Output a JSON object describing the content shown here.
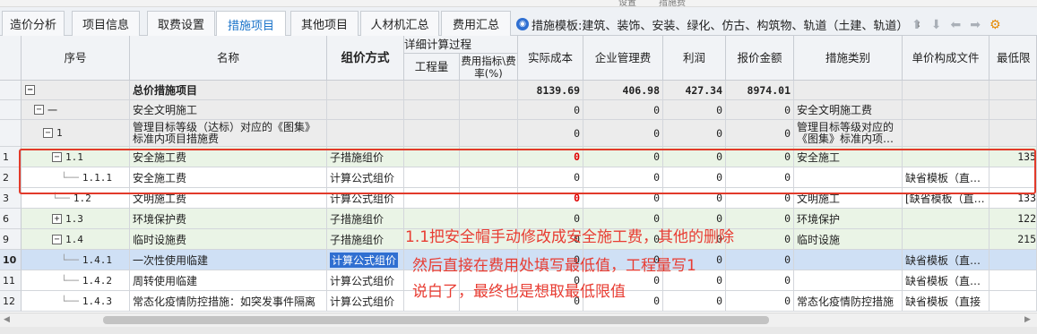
{
  "top_strip": [
    "设置",
    "措施费"
  ],
  "tabs": [
    {
      "label": "造价分析",
      "active": false
    },
    {
      "label": "项目信息",
      "active": false
    },
    {
      "label": "取费设置",
      "active": false
    },
    {
      "label": "措施项目",
      "active": true
    },
    {
      "label": "其他项目",
      "active": false
    },
    {
      "label": "人材机汇总",
      "active": false
    },
    {
      "label": "费用汇总",
      "active": false
    }
  ],
  "template": {
    "label": "措施模板:建筑、装饰、安装、绿化、仿古、构筑物、轨道（土建、轨道）",
    "dropdown_icon": "sort-arrows-icon"
  },
  "toolbar_icons": [
    "up-arrow-icon",
    "down-arrow-icon",
    "left-arrow-icon",
    "right-arrow-icon",
    "settings-icon"
  ],
  "headers": {
    "seq": "序号",
    "name": "名称",
    "pricing_method": "组价方式",
    "detail_group": "详细计算过程",
    "quantity": "工程量",
    "fee_rate": "费用指标\\费率(%)",
    "actual_cost": "实际成本",
    "mgmt_fee": "企业管理费",
    "profit": "利润",
    "quote_amount": "报价金额",
    "category": "措施类别",
    "unit_file": "单价构成文件",
    "min_limit": "最低限"
  },
  "rows": [
    {
      "rownum": "",
      "seq": "",
      "toggle": "−",
      "name": "总价措施项目",
      "method": "",
      "qty": "",
      "rate": "",
      "cost": "8139.69",
      "mgmt": "406.98",
      "profit": "427.34",
      "quote": "8974.01",
      "category": "",
      "unitfile": "",
      "min": "",
      "bold": true,
      "bg": "#ececec",
      "height": 22
    },
    {
      "rownum": "",
      "seq": "一",
      "toggle": "−",
      "name": "安全文明施工",
      "method": "",
      "qty": "",
      "rate": "",
      "cost": "0",
      "mgmt": "0",
      "profit": "0",
      "quote": "0",
      "category": "安全文明施工费",
      "unitfile": "",
      "min": "",
      "bold": false,
      "bg": "#ececec",
      "height": 22
    },
    {
      "rownum": "",
      "seq": "1",
      "toggle": "−",
      "name": "管理目标等级（达标）对应的《图集》标准内项目措施费",
      "method": "",
      "qty": "",
      "rate": "",
      "cost": "0",
      "mgmt": "0",
      "profit": "0",
      "quote": "0",
      "category": "管理目标等级对应的《图集》标准内项…",
      "unitfile": "",
      "min": "",
      "bold": false,
      "bg": "#ececec",
      "height": 30
    },
    {
      "rownum": "1",
      "seq": "1.1",
      "toggle": "−",
      "name": "安全施工费",
      "method": "子措施组价",
      "qty": "",
      "rate": "",
      "cost": "0",
      "mgmt": "0",
      "profit": "0",
      "quote": "0",
      "category": "安全施工",
      "unitfile": "",
      "min": "135",
      "bold": false,
      "bg": "#eaf4e6",
      "height": 23,
      "redcost": true
    },
    {
      "rownum": "2",
      "seq": "1.1.1",
      "toggle": "",
      "name": "安全施工费",
      "method": "计算公式组价",
      "qty": "",
      "rate": "",
      "cost": "0",
      "mgmt": "0",
      "profit": "0",
      "quote": "0",
      "category": "",
      "unitfile": "缺省模板（直…",
      "min": "",
      "bold": false,
      "bg": "#ffffff",
      "height": 23
    },
    {
      "rownum": "3",
      "seq": "1.2",
      "toggle": "",
      "name": "文明施工费",
      "method": "计算公式组价",
      "qty": "",
      "rate": "",
      "cost": "0",
      "mgmt": "0",
      "profit": "0",
      "quote": "0",
      "category": "文明施工",
      "unitfile": "[缺省模板（直…",
      "min": "133",
      "bold": false,
      "bg": "#ffffff",
      "height": 23,
      "redcost": true
    },
    {
      "rownum": "6",
      "seq": "1.3",
      "toggle": "+",
      "name": "环境保护费",
      "method": "子措施组价",
      "qty": "",
      "rate": "",
      "cost": "0",
      "mgmt": "0",
      "profit": "0",
      "quote": "0",
      "category": "环境保护",
      "unitfile": "",
      "min": "122",
      "bold": false,
      "bg": "#eaf4e6",
      "height": 23
    },
    {
      "rownum": "9",
      "seq": "1.4",
      "toggle": "−",
      "name": "临时设施费",
      "method": "子措施组价",
      "qty": "",
      "rate": "",
      "cost": "0",
      "mgmt": "0",
      "profit": "0",
      "quote": "0",
      "category": "临时设施",
      "unitfile": "",
      "min": "215",
      "bold": false,
      "bg": "#eaf4e6",
      "height": 23
    },
    {
      "rownum": "10",
      "seq": "1.4.1",
      "toggle": "",
      "name": "一次性使用临建",
      "method": "计算公式组价",
      "qty": "",
      "rate": "",
      "cost": "0",
      "mgmt": "0",
      "profit": "0",
      "quote": "0",
      "category": "",
      "unitfile": "缺省模板（直…",
      "min": "",
      "bold": false,
      "bg": "#cfe0f5",
      "height": 23,
      "selected": true
    },
    {
      "rownum": "11",
      "seq": "1.4.2",
      "toggle": "",
      "name": "周转使用临建",
      "method": "计算公式组价",
      "qty": "",
      "rate": "",
      "cost": "0",
      "mgmt": "0",
      "profit": "0",
      "quote": "0",
      "category": "",
      "unitfile": "缺省模板（直…",
      "min": "",
      "bold": false,
      "bg": "#ffffff",
      "height": 23
    },
    {
      "rownum": "12",
      "seq": "1.4.3",
      "toggle": "",
      "name": "常态化疫情防控措施：如突发事件隔离",
      "method": "计算公式组价",
      "qty": "",
      "rate": "",
      "cost": "0",
      "mgmt": "0",
      "profit": "0",
      "quote": "0",
      "category": "常态化疫情防控措施",
      "unitfile": "缺省模板（直接",
      "min": "",
      "bold": false,
      "bg": "#ffffff",
      "height": 23
    }
  ],
  "annotation": {
    "line1": "1.1把安全帽手动修改成安全施工费，其他的删除",
    "line2": "然后直接在费用处填写最低值，工程量写1",
    "line3": "说白了，最终也是想取最低限值"
  },
  "colors": {
    "accent": "#1a73c9",
    "annotation_red": "#e83c32",
    "selected_row": "#cfe0f5",
    "group_row": "#eaf4e6"
  }
}
